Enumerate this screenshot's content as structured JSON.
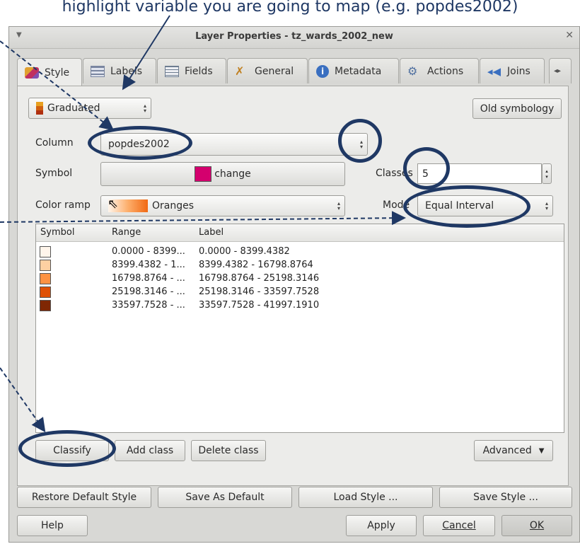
{
  "caption": "highlight variable you are going to map (e.g. popdes2002)",
  "window": {
    "title": "Layer Properties - tz_wards_2002_new"
  },
  "tabs": [
    {
      "label": "Style",
      "icon": "paint-brush-icon"
    },
    {
      "label": "Labels",
      "icon": "label-icon"
    },
    {
      "label": "Fields",
      "icon": "table-icon"
    },
    {
      "label": "General",
      "icon": "tools-icon"
    },
    {
      "label": "Metadata",
      "icon": "info-icon"
    },
    {
      "label": "Actions",
      "icon": "gears-icon"
    },
    {
      "label": "Joins",
      "icon": "join-icon"
    }
  ],
  "renderer": {
    "value": "Graduated",
    "old_symbology_label": "Old symbology"
  },
  "column": {
    "label": "Column",
    "value": "popdes2002"
  },
  "symbol": {
    "label": "Symbol",
    "button_label": "change",
    "color": "#d4006e"
  },
  "color_ramp": {
    "label": "Color ramp",
    "value": "Oranges"
  },
  "classes": {
    "label": "Classes",
    "value": "5"
  },
  "mode": {
    "label": "Mode",
    "value": "Equal Interval"
  },
  "table": {
    "headers": [
      "Symbol",
      "Range",
      "Label"
    ],
    "rows": [
      {
        "color": "#fff5eb",
        "range": "0.0000 - 8399...",
        "label": "0.0000 - 8399.4382"
      },
      {
        "color": "#fdd0a2",
        "range": "8399.4382 - 1...",
        "label": "8399.4382 - 16798.8764"
      },
      {
        "color": "#fd9243",
        "range": "16798.8764 - ...",
        "label": "16798.8764 - 25198.3146"
      },
      {
        "color": "#df5005",
        "range": "25198.3146 - ...",
        "label": "25198.3146 - 33597.7528"
      },
      {
        "color": "#7f2704",
        "range": "33597.7528 - ...",
        "label": "33597.7528 - 41997.1910"
      }
    ]
  },
  "buttons": {
    "classify": "Classify",
    "add_class": "Add class",
    "delete_class": "Delete class",
    "advanced": "Advanced",
    "restore_default": "Restore Default Style",
    "save_default": "Save As Default",
    "load_style": "Load Style ...",
    "save_style": "Save Style ...",
    "help": "Help",
    "apply": "Apply",
    "cancel": "Cancel",
    "ok": "OK"
  },
  "colors": {
    "annotation": "#1f3864"
  }
}
